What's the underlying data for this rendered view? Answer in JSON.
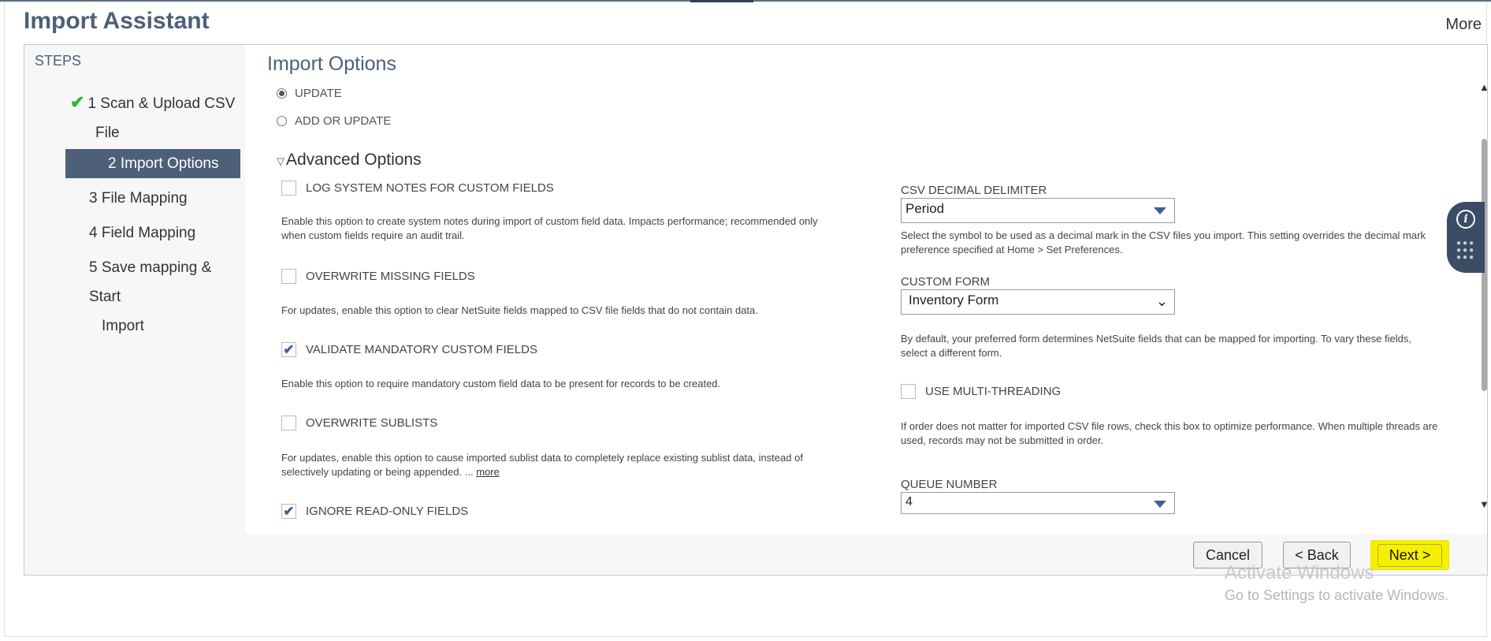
{
  "page": {
    "title": "Import Assistant",
    "more_label": "More"
  },
  "steps": {
    "header": "STEPS",
    "items": [
      {
        "label": "1 Scan & Upload CSV File",
        "line1": "1 Scan & Upload CSV",
        "line2": "File",
        "status": "done"
      },
      {
        "label": "2 Import Options",
        "status": "active"
      },
      {
        "label": "3 File Mapping"
      },
      {
        "label": "4 Field Mapping"
      },
      {
        "label": "5 Save mapping & Start Import",
        "line1": "5 Save mapping & Start",
        "line2": "Import"
      }
    ]
  },
  "import_options": {
    "title": "Import Options",
    "radios": [
      {
        "label": "UPDATE",
        "selected": true
      },
      {
        "label": "ADD OR UPDATE",
        "selected": false
      }
    ]
  },
  "advanced": {
    "title": "Advanced Options",
    "left_options": [
      {
        "label": "LOG SYSTEM NOTES FOR CUSTOM FIELDS",
        "checked": false,
        "help_1": "Enable this option to create system notes during import of custom field data. Impacts performance; recommended only",
        "help_2": "when custom fields require an audit trail."
      },
      {
        "label": "OVERWRITE MISSING FIELDS",
        "checked": false,
        "help_1": "For updates, enable this option to clear NetSuite fields mapped to CSV file fields that do not contain data."
      },
      {
        "label": "VALIDATE MANDATORY CUSTOM FIELDS",
        "checked": true,
        "help_1": "Enable this option to require mandatory custom field data to be present for records to be created."
      },
      {
        "label": "OVERWRITE SUBLISTS",
        "checked": false,
        "help_1": "For updates, enable this option to cause imported sublist data to completely replace existing sublist data, instead of",
        "help_2": "selectively updating or being appended. ...",
        "more": "more"
      },
      {
        "label": "IGNORE READ-ONLY FIELDS",
        "checked": true
      }
    ],
    "csv_decimal": {
      "label": "CSV DECIMAL DELIMITER",
      "value": "Period",
      "help_1": "Select the symbol to be used as a decimal mark in the CSV files you import. This setting overrides the decimal mark",
      "help_2": "preference specified at Home > Set Preferences."
    },
    "custom_form": {
      "label": "CUSTOM FORM",
      "value": "Inventory Form",
      "help_1": "By default, your preferred form determines NetSuite fields that can be mapped for importing. To vary these fields,",
      "help_2": "select a different form."
    },
    "multi_threading": {
      "label": "USE MULTI-THREADING",
      "checked": false,
      "help_1": "If order does not matter for imported CSV file rows, check this box to optimize performance. When multiple threads are",
      "help_2": "used, records may not be submitted in order."
    },
    "queue_number": {
      "label": "QUEUE NUMBER",
      "value": "4"
    }
  },
  "buttons": {
    "cancel": "Cancel",
    "back": "< Back",
    "next": "Next >"
  },
  "watermark": {
    "line1": "Activate Windows",
    "line2": "Go to Settings to activate Windows."
  },
  "icons": {
    "check": "check-icon",
    "info": "info-icon",
    "grid": "grid-dots-icon"
  }
}
